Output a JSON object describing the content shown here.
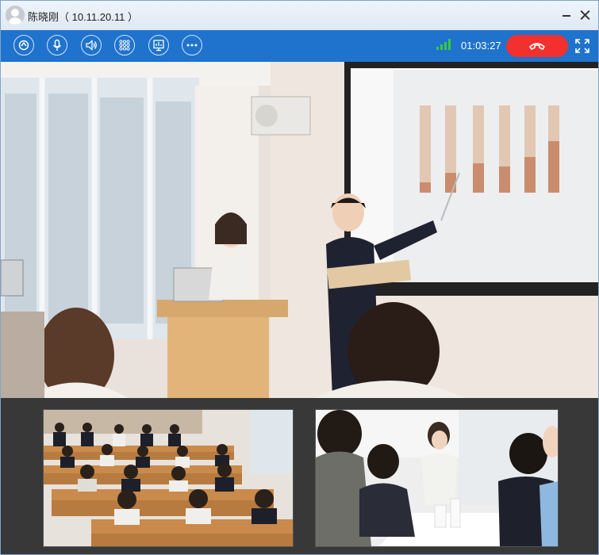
{
  "window": {
    "title": "陈晓刚（ 10.11.20.11 ）"
  },
  "toolbar": {
    "buttons": [
      {
        "name": "camera-switch",
        "icon": "camera-switch-icon"
      },
      {
        "name": "microphone",
        "icon": "microphone-icon"
      },
      {
        "name": "speaker",
        "icon": "speaker-icon"
      },
      {
        "name": "dialpad",
        "icon": "dialpad-icon"
      },
      {
        "name": "screen-share",
        "icon": "screen-share-icon"
      },
      {
        "name": "more",
        "icon": "more-icon"
      }
    ],
    "call_duration": "01:03:27",
    "signal_color": "#3cc83c",
    "hangup_color": "#f2302e",
    "accent_color": "#1f73cc"
  },
  "videos": {
    "main": {
      "icon": "presentation-video-feed"
    },
    "thumbnails": [
      {
        "icon": "classroom-video-feed"
      },
      {
        "icon": "meeting-video-feed"
      }
    ]
  }
}
